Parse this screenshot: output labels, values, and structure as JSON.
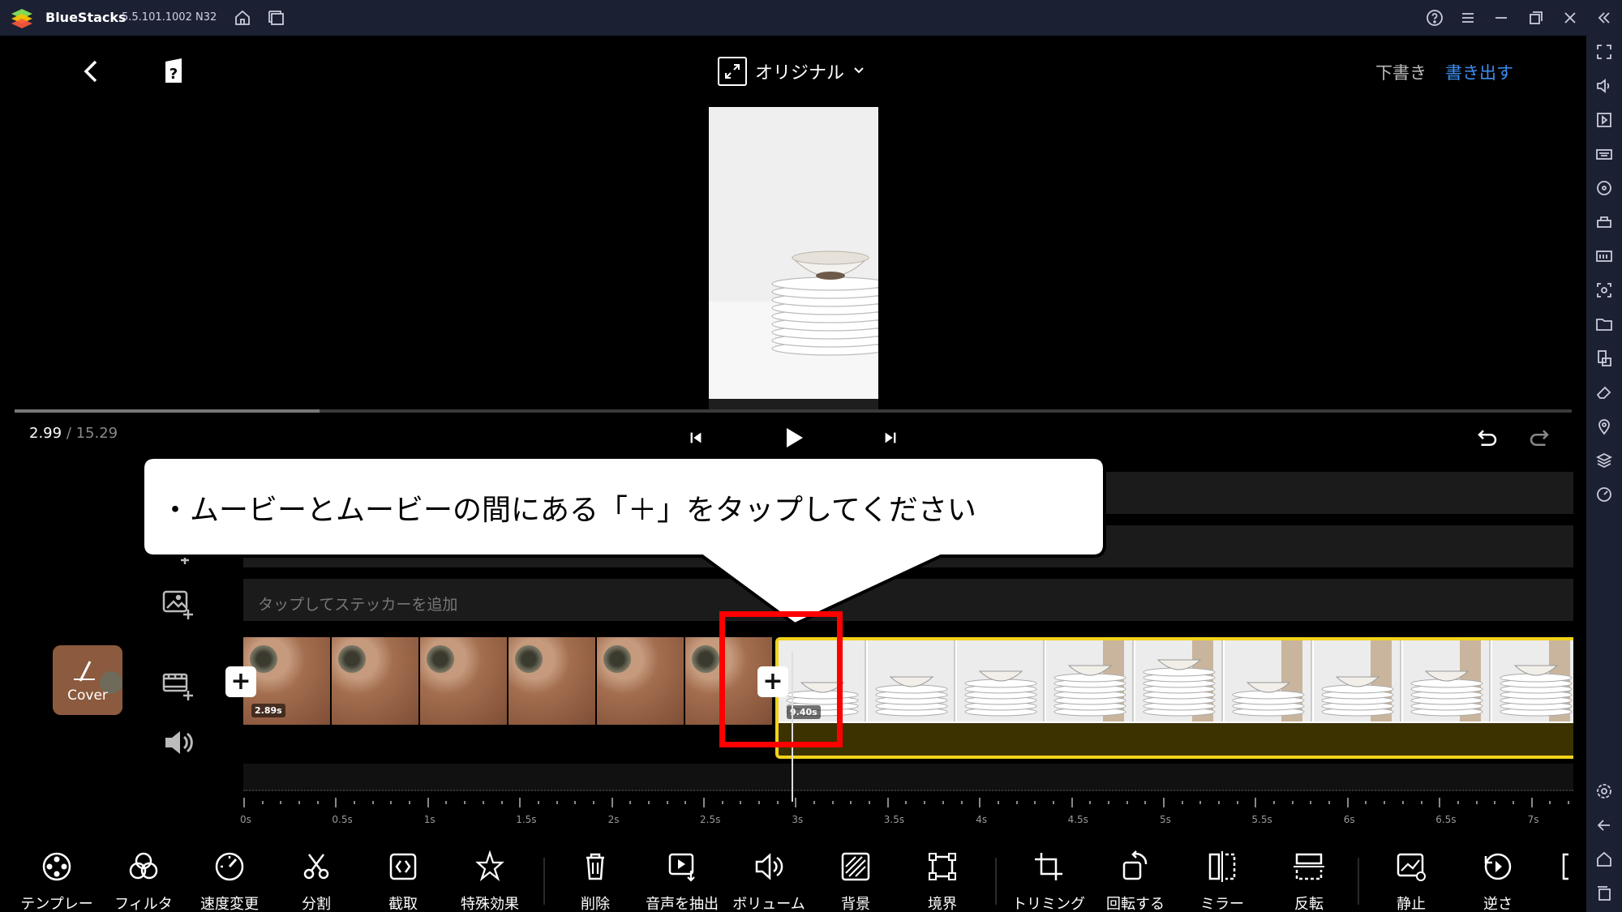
{
  "window": {
    "app_name": "BlueStacks",
    "version": "5.5.101.1002  N32"
  },
  "editor": {
    "aspect_label": "オリジナル",
    "draft_label": "下書き",
    "export_label": "書き出す",
    "export_color": "#3d8ef0",
    "current_time": "2.99",
    "total_time": "/ 15.29",
    "progress_fraction": 0.196,
    "sticker_placeholder": "タップしてステッカーを追加",
    "cover_label": "Cover",
    "clip1_duration": "2.89s",
    "clip2_duration": "9.40s",
    "clip2_border_color": "#f2d21c",
    "ruler_labels": [
      "0s",
      "0.5s",
      "1s",
      "1.5s",
      "2s",
      "2.5s",
      "3s",
      "3.5s",
      "4s",
      "4.5s",
      "5s",
      "5.5s",
      "6s",
      "6.5s",
      "7s"
    ]
  },
  "toolbar": {
    "items": [
      {
        "label": "テンプレート",
        "icon": "template-icon"
      },
      {
        "label": "フィルタ",
        "icon": "filter-icon"
      },
      {
        "label": "速度変更",
        "icon": "speed-icon"
      },
      {
        "label": "分割",
        "icon": "scissors-icon"
      },
      {
        "label": "截取",
        "icon": "trim-icon"
      },
      {
        "label": "特殊効果",
        "icon": "effects-icon"
      },
      {
        "label": "削除",
        "icon": "trash-icon"
      },
      {
        "label": "音声を抽出する",
        "icon": "extract-audio-icon"
      },
      {
        "label": "ボリューム",
        "icon": "volume-icon"
      },
      {
        "label": "背景",
        "icon": "background-icon"
      },
      {
        "label": "境界",
        "icon": "border-icon"
      },
      {
        "label": "トリミング",
        "icon": "crop-icon"
      },
      {
        "label": "回転する",
        "icon": "rotate-icon"
      },
      {
        "label": "ミラー",
        "icon": "mirror-icon"
      },
      {
        "label": "反転",
        "icon": "flip-icon"
      },
      {
        "label": "静止",
        "icon": "freeze-icon"
      },
      {
        "label": "逆さ",
        "icon": "reverse-icon"
      }
    ]
  },
  "annotation": {
    "callout_text": "・ムービーとムービーの間にある「＋」をタップしてください",
    "highlight_color": "#ff0000"
  }
}
